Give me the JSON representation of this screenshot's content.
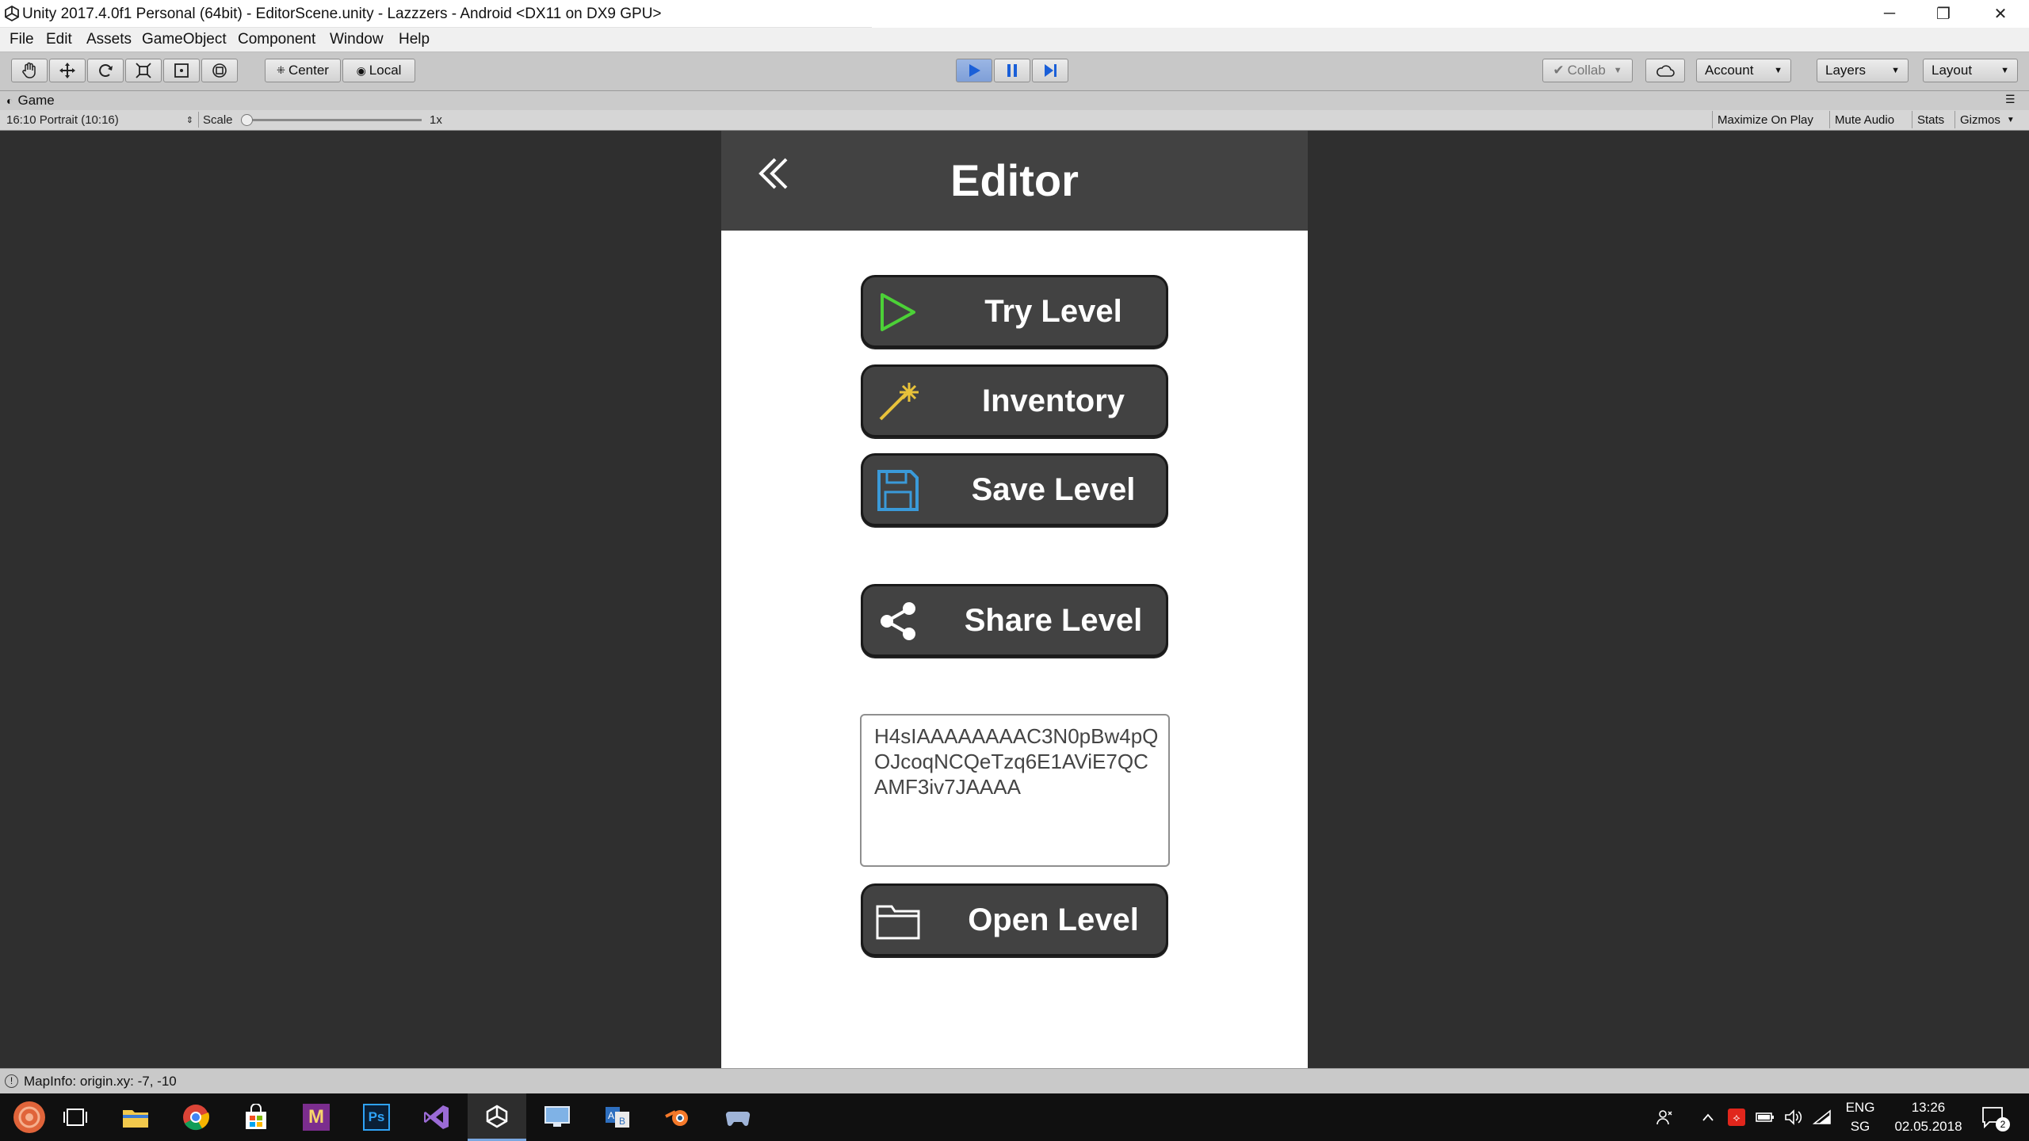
{
  "window": {
    "title": "Unity 2017.4.0f1 Personal (64bit) - EditorScene.unity - Lazzzers - Android <DX11 on DX9 GPU>",
    "minimize": "─",
    "restore": "❐",
    "close": "✕"
  },
  "menu": [
    "File",
    "Edit",
    "Assets",
    "GameObject",
    "Component",
    "Window",
    "Help"
  ],
  "toolbar": {
    "pivot_center": "Center",
    "pivot_local": "Local",
    "collab": "Collab",
    "account": "Account",
    "layers": "Layers",
    "layout": "Layout"
  },
  "game_tab": {
    "label": "Game",
    "aspect": "16:10 Portrait (10:16)",
    "scale_label": "Scale",
    "scale_value": "1x",
    "maximize_on_play": "Maximize On Play",
    "mute_audio": "Mute Audio",
    "stats": "Stats",
    "gizmos": "Gizmos"
  },
  "game": {
    "header_title": "Editor",
    "buttons": {
      "try": "Try Level",
      "inventory": "Inventory",
      "save": "Save Level",
      "share": "Share Level",
      "open": "Open Level"
    },
    "level_code": "H4sIAAAAAAAAC3N0pBw4pQOJcoqNCQeTzq6E1AViE7QCAMF3iv7JAAAA"
  },
  "status": {
    "text": "MapInfo: origin.xy: -7, -10"
  },
  "taskbar": {
    "language": "ENG",
    "region": "SG",
    "time": "13:26",
    "date": "02.05.2018",
    "notification_count": "2"
  },
  "colors": {
    "play_active": "#7f9fd8",
    "game_header": "#424242",
    "game_button": "#424242",
    "try_icon": "#4cd137",
    "save_icon": "#3a9ad9",
    "wand_icon": "#e8c23a"
  }
}
